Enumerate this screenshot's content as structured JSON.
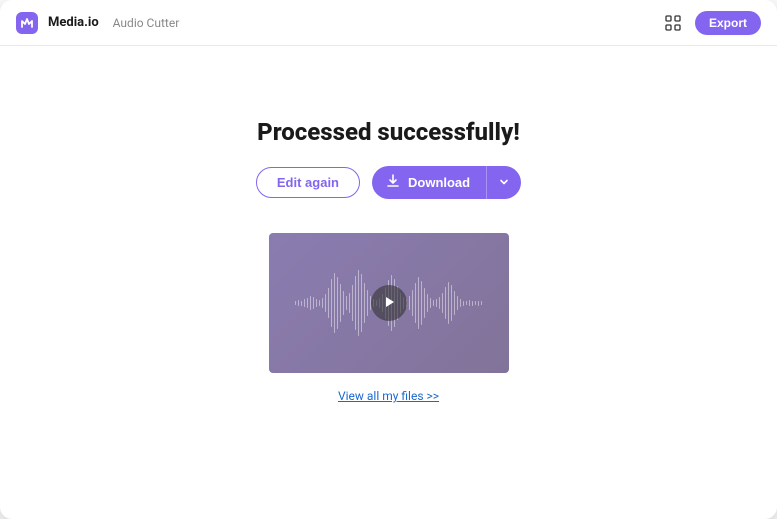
{
  "header": {
    "brand": "Media.io",
    "app": "Audio Cutter",
    "export_label": "Export"
  },
  "main": {
    "title": "Processed successfully!",
    "edit_label": "Edit again",
    "download_label": "Download",
    "view_files_label": "View all my files >>"
  },
  "colors": {
    "primary": "#8365f0",
    "link": "#1a69cf"
  }
}
